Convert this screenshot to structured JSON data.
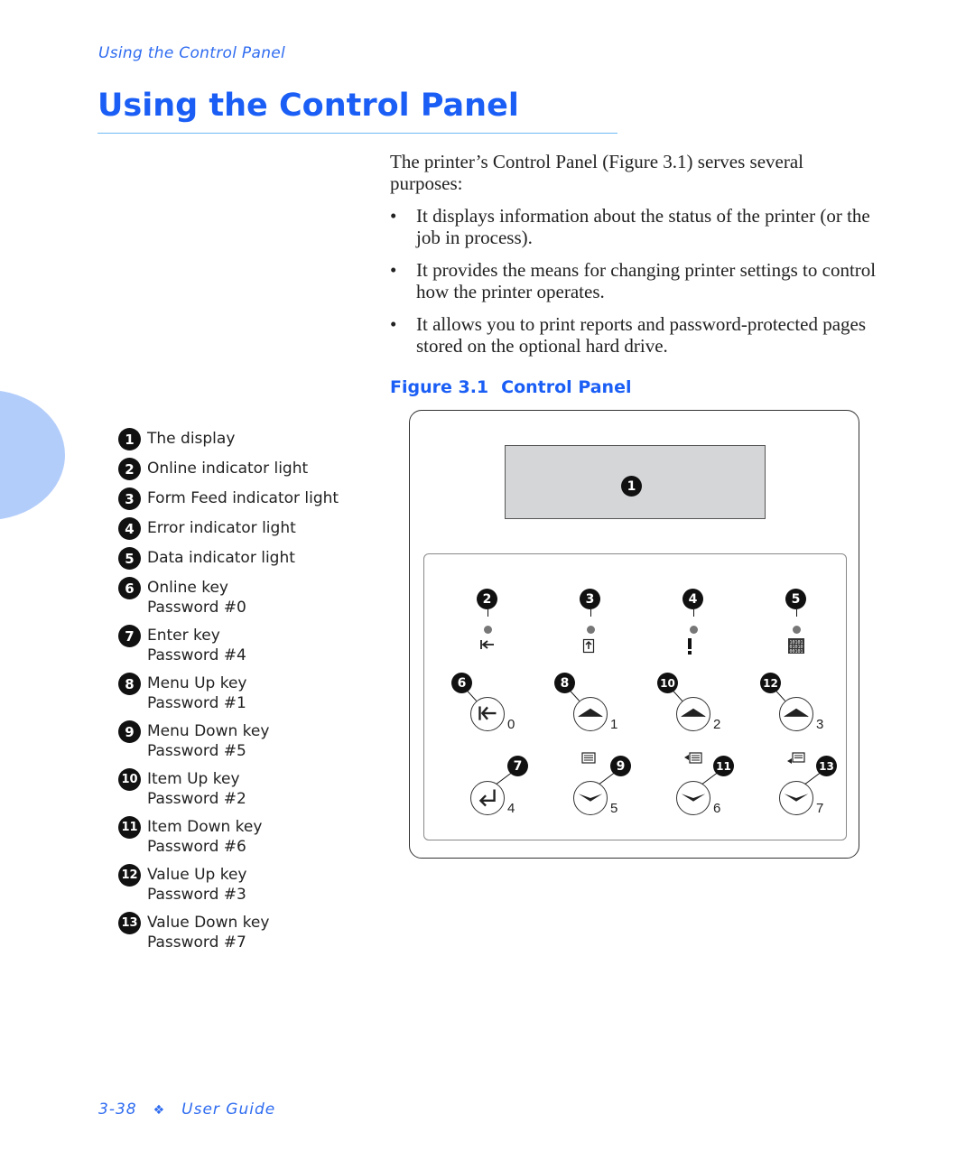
{
  "running_head": "Using the Control Panel",
  "page_title": "Using the Control Panel",
  "intro": {
    "paragraph": "The printer’s Control Panel (Figure 3.1) serves several purposes:",
    "bullets": [
      "It displays information about the status of the printer (or the job in process).",
      "It provides the means for changing printer settings to control how the printer operates.",
      "It allows you to print reports and password-protected pages stored on the optional hard drive."
    ],
    "bullet_glyph": "•"
  },
  "figure": {
    "number": "Figure 3.1",
    "title": "Control Panel"
  },
  "legend": [
    {
      "num": "1",
      "label": "The display",
      "sub": ""
    },
    {
      "num": "2",
      "label": "Online indicator light",
      "sub": ""
    },
    {
      "num": "3",
      "label": "Form Feed indicator light",
      "sub": ""
    },
    {
      "num": "4",
      "label": "Error indicator light",
      "sub": ""
    },
    {
      "num": "5",
      "label": "Data indicator light",
      "sub": ""
    },
    {
      "num": "6",
      "label": "Online key",
      "sub": "Password #0"
    },
    {
      "num": "7",
      "label": "Enter key",
      "sub": "Password #4"
    },
    {
      "num": "8",
      "label": "Menu Up key",
      "sub": "Password #1"
    },
    {
      "num": "9",
      "label": "Menu Down key",
      "sub": "Password #5"
    },
    {
      "num": "10",
      "label": "Item Up key",
      "sub": "Password #2"
    },
    {
      "num": "11",
      "label": "Item Down key",
      "sub": "Password #6"
    },
    {
      "num": "12",
      "label": "Value Up key",
      "sub": "Password #3"
    },
    {
      "num": "13",
      "label": "Value Down key",
      "sub": "Password #7"
    }
  ],
  "panel": {
    "display_callout": "1",
    "indicators": [
      {
        "callout": "2",
        "icon": "online-arrow-icon"
      },
      {
        "callout": "3",
        "icon": "form-feed-icon"
      },
      {
        "callout": "4",
        "icon": "error-exclamation-icon"
      },
      {
        "callout": "5",
        "icon": "data-binary-icon"
      }
    ],
    "top_keys": [
      {
        "callout": "6",
        "digit": "0",
        "icon": "online-key-icon"
      },
      {
        "callout": "8",
        "digit": "1",
        "icon": "chevron-up-icon"
      },
      {
        "callout": "10",
        "digit": "2",
        "icon": "chevron-up-icon"
      },
      {
        "callout": "12",
        "digit": "3",
        "icon": "chevron-up-icon"
      }
    ],
    "bottom_keys": [
      {
        "callout": "7",
        "digit": "4",
        "icon": "enter-key-icon"
      },
      {
        "callout": "9",
        "digit": "5",
        "icon": "chevron-down-icon"
      },
      {
        "callout": "11",
        "digit": "6",
        "icon": "chevron-down-icon"
      },
      {
        "callout": "13",
        "digit": "7",
        "icon": "chevron-down-icon"
      }
    ]
  },
  "footer": {
    "page_number": "3-38",
    "separator": "❖",
    "doc_title": "User Guide"
  }
}
